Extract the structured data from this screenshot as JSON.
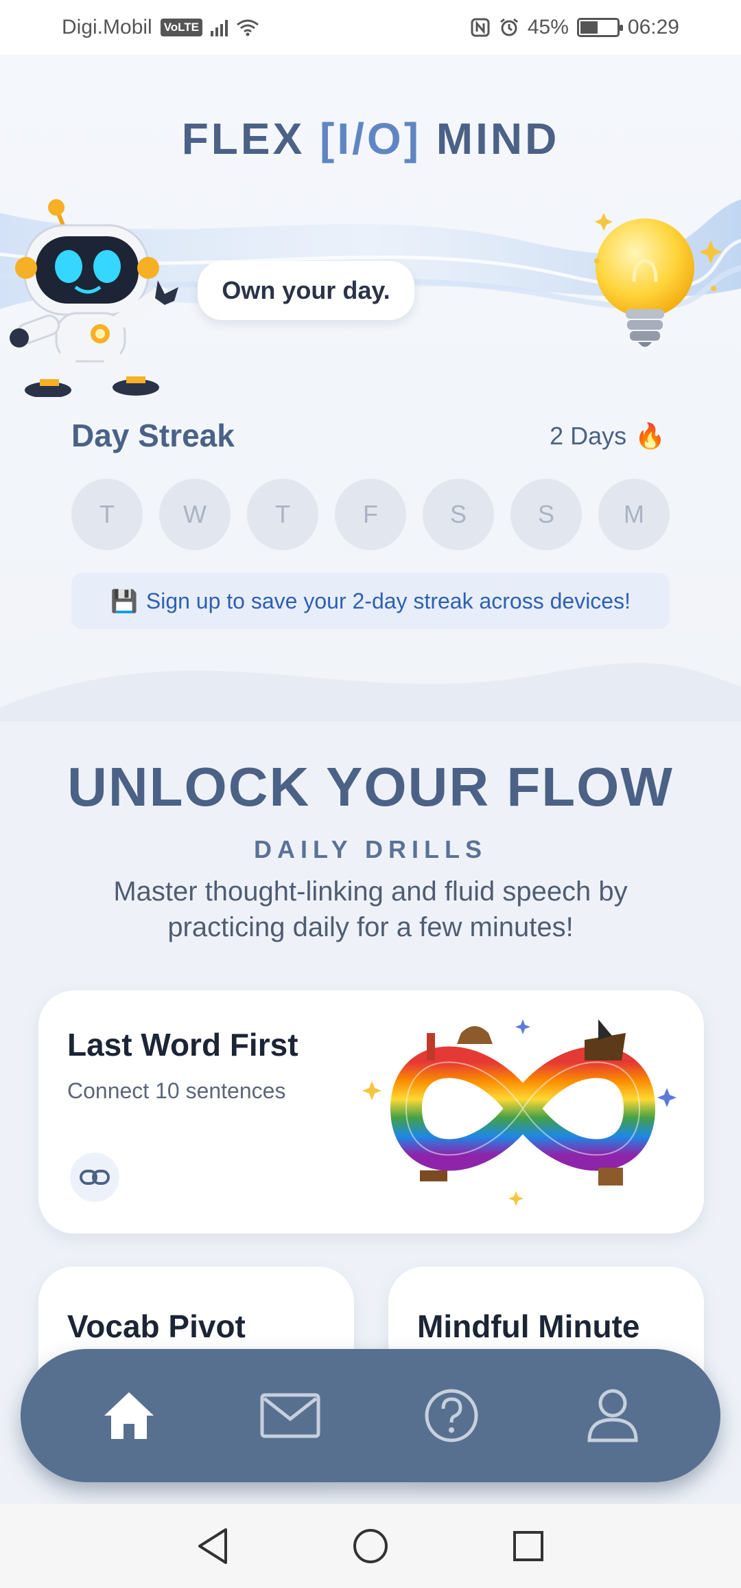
{
  "status_bar": {
    "carrier": "Digi.Mobil",
    "volte": "VoLTE",
    "battery": "45%",
    "time": "06:29"
  },
  "app": {
    "title_part1": "FLEX",
    "title_part2": "[I/O]",
    "title_part3": "MIND"
  },
  "hero": {
    "bubble_text": "Own your day."
  },
  "streak": {
    "title": "Day Streak",
    "count_label": "2 Days",
    "count_icon": "🔥",
    "days": [
      "T",
      "W",
      "T",
      "F",
      "S",
      "S",
      "M"
    ],
    "signup_icon": "💾",
    "signup_text": "Sign up to save your 2-day streak across devices!"
  },
  "unlock": {
    "title": "UNLOCK YOUR FLOW",
    "subtitle": "DAILY DRILLS",
    "description": "Master thought-linking and fluid speech by practicing daily for a few minutes!"
  },
  "cards": {
    "main": {
      "title": "Last Word First",
      "subtitle": "Connect 10 sentences",
      "link_icon": "link-icon"
    },
    "left": {
      "title": "Vocab Pivot"
    },
    "right": {
      "title": "Mindful Minute"
    }
  },
  "nav": {
    "items": [
      "home-icon",
      "mail-icon",
      "help-icon",
      "profile-icon"
    ]
  },
  "colors": {
    "accent": "#4b6186",
    "nav_bg": "#58708f",
    "link_blue": "#2f5fb3"
  }
}
